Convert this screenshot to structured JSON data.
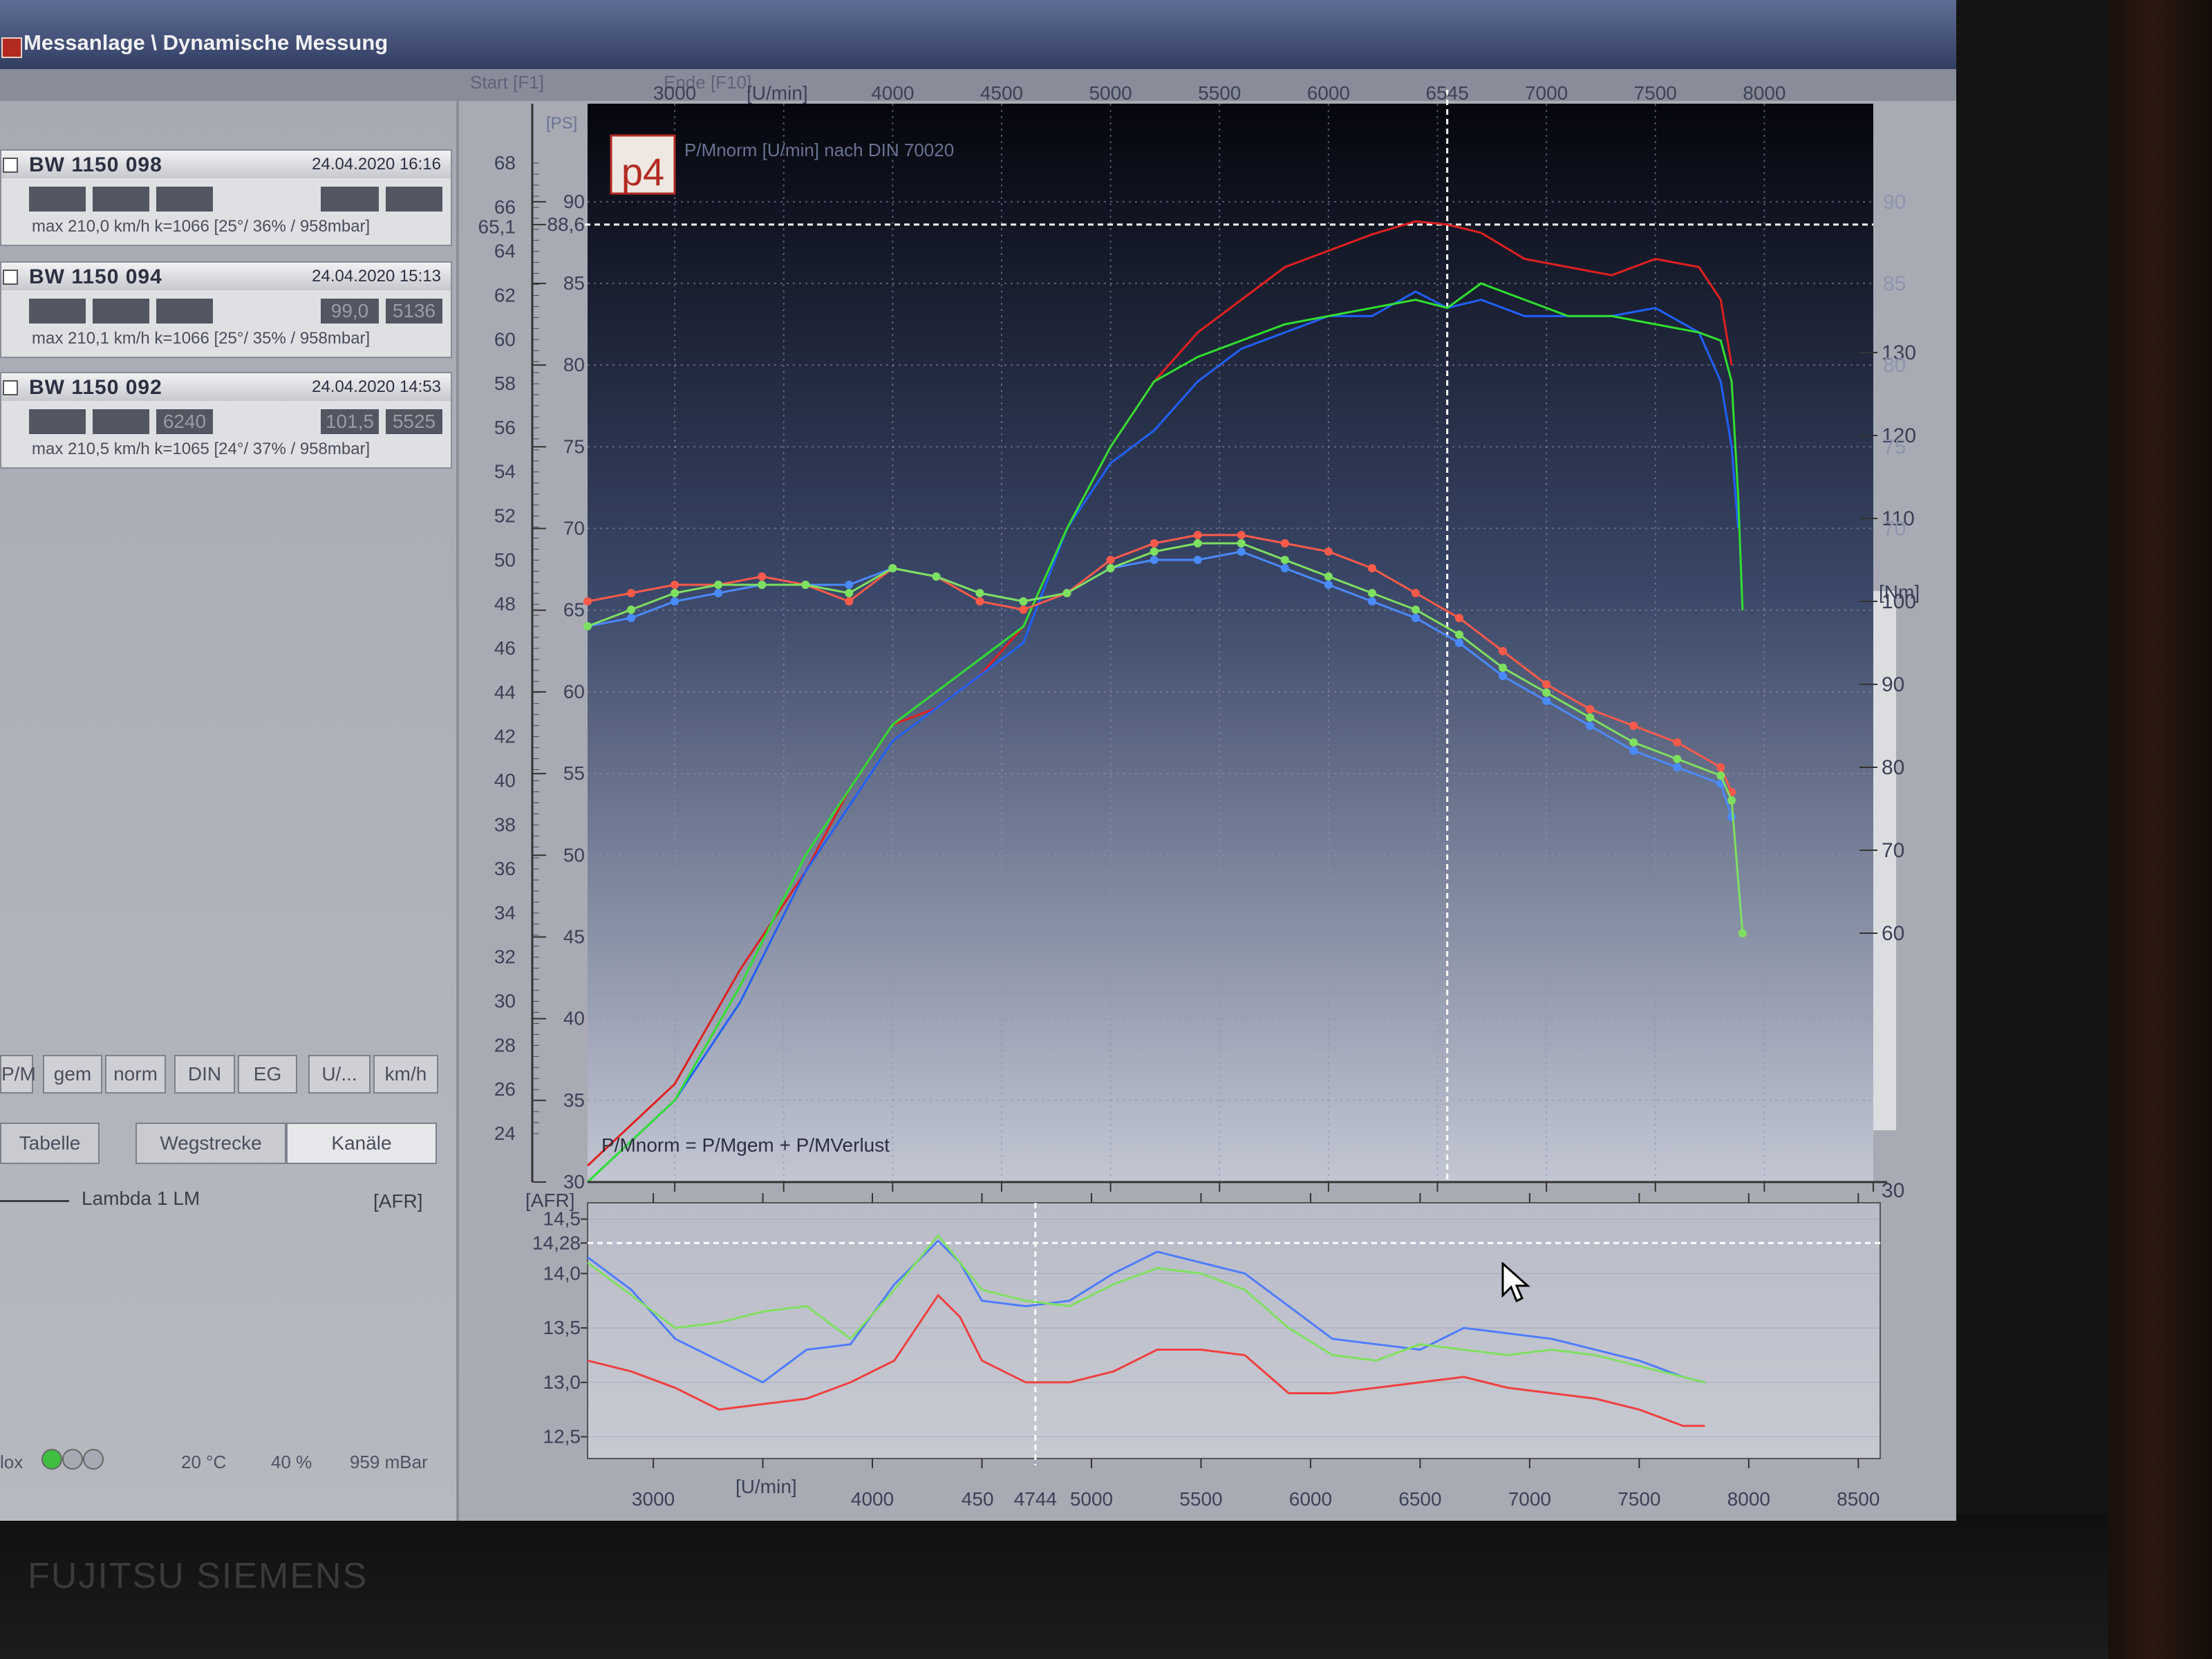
{
  "window": {
    "title": "Messanlage \\ Dynamische Messung"
  },
  "menu": {
    "items": [
      "Start [F1]",
      "Ende [F10]"
    ]
  },
  "runs": [
    {
      "name": "BW 1150 098",
      "date": "24.04.2020 16:16",
      "boxes": [
        "",
        "",
        "",
        "",
        ""
      ],
      "info": "max 210,0 km/h   k=1066    [25°/ 36% / 958mbar]",
      "color": "#e02020"
    },
    {
      "name": "BW 1150 094",
      "date": "24.04.2020 15:13",
      "boxes": [
        "",
        "",
        "",
        "99,0",
        "5136"
      ],
      "info": "max 210,1 km/h   k=1066    [25°/ 35% / 958mbar]",
      "color": "#2060ff"
    },
    {
      "name": "BW 1150 092",
      "date": "24.04.2020 14:53",
      "boxes": [
        "",
        "",
        "6240",
        "101,5",
        "5525"
      ],
      "info": "max 210,5 km/h   k=1065    [24°/ 37% / 958mbar]",
      "color": "#30e030"
    }
  ],
  "buttons": [
    "P/M",
    "gem",
    "norm",
    "DIN",
    "EG",
    "U/...",
    "km/h"
  ],
  "tabs": [
    "Tabelle",
    "Wegstrecke",
    "Kanäle"
  ],
  "channel": {
    "label": "Lambda 1 LM",
    "unit": "[AFR]"
  },
  "status": {
    "temp": "20 °C",
    "humidity": "40 %",
    "pressure": "959 mBar",
    "label": "lox"
  },
  "chart_data": [
    {
      "type": "line",
      "title": "P/Mnorm [U/min] nach DIN 70020",
      "logo": "p4",
      "footnote": "P/Mnorm = P/Mgem + P/MVerlust",
      "xlabel": "[U/min]",
      "x_ticks": [
        "3000",
        "4000",
        "4500",
        "5000",
        "5500",
        "6000",
        "6545",
        "7000",
        "7500",
        "8000"
      ],
      "xlim": [
        2600,
        8500
      ],
      "y_left_ps_ticks": [
        "24",
        "26",
        "28",
        "30",
        "32",
        "34",
        "36",
        "38",
        "40",
        "42",
        "44",
        "46",
        "48",
        "50",
        "52",
        "54",
        "56",
        "58",
        "60",
        "62",
        "64",
        "65,1",
        "66",
        "68"
      ],
      "y_left_kw_ticks": [
        "30",
        "35",
        "40",
        "45",
        "50",
        "55",
        "60",
        "65",
        "70",
        "75",
        "80",
        "85",
        "88,6",
        "90"
      ],
      "y_left_kw_label": "[PS]",
      "y_right_nm_ticks": [
        "30",
        "60",
        "70",
        "80",
        "90",
        "100",
        "110",
        "120",
        "130"
      ],
      "y_right_nm_label": "[Nm]",
      "y_right_power_ticks": [
        "70",
        "75",
        "80",
        "85",
        "90"
      ],
      "cursor": {
        "x": 6545,
        "y": 88.6
      },
      "power_unit_ylim": [
        30,
        96
      ],
      "torque_unit_ylim": [
        30,
        160
      ],
      "series": [
        {
          "name": "BW 1150 098",
          "color": "#e02020",
          "kind": "power",
          "x": [
            2600,
            3000,
            3300,
            3600,
            3800,
            4000,
            4200,
            4400,
            4600,
            4800,
            5000,
            5200,
            5400,
            5600,
            5800,
            6000,
            6200,
            6400,
            6545,
            6700,
            6900,
            7100,
            7300,
            7500,
            7700,
            7800,
            7850
          ],
          "y": [
            31,
            36,
            43,
            49,
            54,
            58,
            59,
            61,
            64,
            70,
            75,
            79,
            82,
            84,
            86,
            87,
            88,
            88.8,
            88.6,
            88.1,
            86.5,
            86,
            85.5,
            86.5,
            86,
            84,
            80
          ]
        },
        {
          "name": "BW 1150 094",
          "color": "#2060ff",
          "kind": "power",
          "x": [
            2600,
            3000,
            3300,
            3600,
            3800,
            4000,
            4200,
            4400,
            4600,
            4800,
            5000,
            5200,
            5400,
            5600,
            5800,
            6000,
            6200,
            6400,
            6545,
            6700,
            6900,
            7100,
            7300,
            7500,
            7700,
            7800,
            7850,
            7880
          ],
          "y": [
            30,
            35,
            41,
            49,
            53,
            57,
            59,
            61,
            63,
            70,
            74,
            76,
            79,
            81,
            82,
            83,
            83,
            84.5,
            83.5,
            84,
            83,
            83,
            83,
            83.5,
            82,
            79,
            75,
            70
          ]
        },
        {
          "name": "BW 1150 092",
          "color": "#30e030",
          "kind": "power",
          "x": [
            2600,
            3000,
            3300,
            3600,
            3800,
            4000,
            4200,
            4400,
            4600,
            4800,
            5000,
            5200,
            5400,
            5600,
            5800,
            6000,
            6200,
            6400,
            6545,
            6700,
            6900,
            7100,
            7300,
            7500,
            7700,
            7800,
            7850,
            7880,
            7900
          ],
          "y": [
            30,
            35,
            42,
            50,
            54,
            58,
            60,
            62,
            64,
            70,
            75,
            79,
            80.5,
            81.5,
            82.5,
            83,
            83.5,
            84,
            83.5,
            85,
            84,
            83,
            83,
            82.5,
            82,
            81.5,
            79,
            72,
            65
          ]
        },
        {
          "name": "BW 1150 098",
          "color": "#ff5a4a",
          "kind": "torque",
          "x": [
            2600,
            2800,
            3000,
            3200,
            3400,
            3600,
            3800,
            4000,
            4200,
            4400,
            4600,
            4800,
            5000,
            5200,
            5400,
            5600,
            5800,
            6000,
            6200,
            6400,
            6600,
            6800,
            7000,
            7200,
            7400,
            7600,
            7800,
            7850
          ],
          "y": [
            100,
            101,
            102,
            102,
            103,
            102,
            100,
            104,
            103,
            100,
            99,
            101,
            105,
            107,
            108,
            108,
            107,
            106,
            104,
            101,
            98,
            94,
            90,
            87,
            85,
            83,
            80,
            77
          ]
        },
        {
          "name": "BW 1150 094",
          "color": "#4a8aff",
          "kind": "torque",
          "x": [
            2600,
            2800,
            3000,
            3200,
            3400,
            3600,
            3800,
            4000,
            4200,
            4400,
            4600,
            4800,
            5000,
            5200,
            5400,
            5600,
            5800,
            6000,
            6200,
            6400,
            6600,
            6800,
            7000,
            7200,
            7400,
            7600,
            7800,
            7850
          ],
          "y": [
            97,
            98,
            100,
            101,
            102,
            102,
            102,
            104,
            103,
            101,
            100,
            101,
            104,
            105,
            105,
            106,
            104,
            102,
            100,
            98,
            95,
            91,
            88,
            85,
            82,
            80,
            78,
            74
          ]
        },
        {
          "name": "BW 1150 092",
          "color": "#7ee060",
          "kind": "torque",
          "x": [
            2600,
            2800,
            3000,
            3200,
            3400,
            3600,
            3800,
            4000,
            4200,
            4400,
            4600,
            4800,
            5000,
            5200,
            5400,
            5600,
            5800,
            6000,
            6200,
            6400,
            6600,
            6800,
            7000,
            7200,
            7400,
            7600,
            7800,
            7850,
            7900
          ],
          "y": [
            97,
            99,
            101,
            102,
            102,
            102,
            101,
            104,
            103,
            101,
            100,
            101,
            104,
            106,
            107,
            107,
            105,
            103,
            101,
            99,
            96,
            92,
            89,
            86,
            83,
            81,
            79,
            76,
            60
          ]
        }
      ]
    },
    {
      "type": "line",
      "ylabel": "[AFR]",
      "xlabel": "[U/min]",
      "x_ticks": [
        "3000",
        "4000",
        "450",
        "4744",
        "5000",
        "5500",
        "6000",
        "6500",
        "7000",
        "7500",
        "8000",
        "8500"
      ],
      "xlim": [
        2700,
        8600
      ],
      "y_ticks": [
        "12,5",
        "13,0",
        "13,5",
        "14,0",
        "14,28",
        "14,5"
      ],
      "ylim": [
        12.3,
        14.65
      ],
      "cursor": {
        "x": 4744,
        "y": 14.28
      },
      "series": [
        {
          "name": "BW 1150 098",
          "color": "#f04040",
          "x": [
            2700,
            2900,
            3100,
            3300,
            3500,
            3700,
            3900,
            4100,
            4300,
            4400,
            4500,
            4700,
            4900,
            5100,
            5300,
            5500,
            5700,
            5900,
            6100,
            6300,
            6500,
            6700,
            6900,
            7100,
            7300,
            7500,
            7700,
            7800
          ],
          "y": [
            13.2,
            13.1,
            12.95,
            12.75,
            12.8,
            12.85,
            13.0,
            13.2,
            13.8,
            13.6,
            13.2,
            13.0,
            13.0,
            13.1,
            13.3,
            13.3,
            13.25,
            12.9,
            12.9,
            12.95,
            13.0,
            13.05,
            12.95,
            12.9,
            12.85,
            12.75,
            12.6,
            12.6
          ]
        },
        {
          "name": "BW 1150 094",
          "color": "#4f7cff",
          "x": [
            2700,
            2900,
            3100,
            3300,
            3500,
            3700,
            3900,
            4100,
            4300,
            4400,
            4500,
            4700,
            4900,
            5100,
            5300,
            5500,
            5700,
            5900,
            6100,
            6300,
            6500,
            6700,
            6900,
            7100,
            7300,
            7500,
            7700,
            7800
          ],
          "y": [
            14.15,
            13.85,
            13.4,
            13.2,
            13.0,
            13.3,
            13.35,
            13.9,
            14.3,
            14.1,
            13.75,
            13.7,
            13.75,
            14.0,
            14.2,
            14.1,
            14.0,
            13.7,
            13.4,
            13.35,
            13.3,
            13.5,
            13.45,
            13.4,
            13.3,
            13.2,
            13.05,
            13.0
          ]
        },
        {
          "name": "BW 1150 092",
          "color": "#80e060",
          "x": [
            2700,
            2900,
            3100,
            3300,
            3500,
            3700,
            3900,
            4100,
            4300,
            4400,
            4500,
            4700,
            4900,
            5100,
            5300,
            5500,
            5700,
            5900,
            6100,
            6300,
            6500,
            6700,
            6900,
            7100,
            7300,
            7500,
            7700,
            7800
          ],
          "y": [
            14.1,
            13.8,
            13.5,
            13.55,
            13.65,
            13.7,
            13.4,
            13.85,
            14.35,
            14.1,
            13.85,
            13.75,
            13.7,
            13.9,
            14.05,
            14.0,
            13.85,
            13.5,
            13.25,
            13.2,
            13.35,
            13.3,
            13.25,
            13.3,
            13.25,
            13.15,
            13.05,
            13.0
          ]
        }
      ]
    }
  ]
}
